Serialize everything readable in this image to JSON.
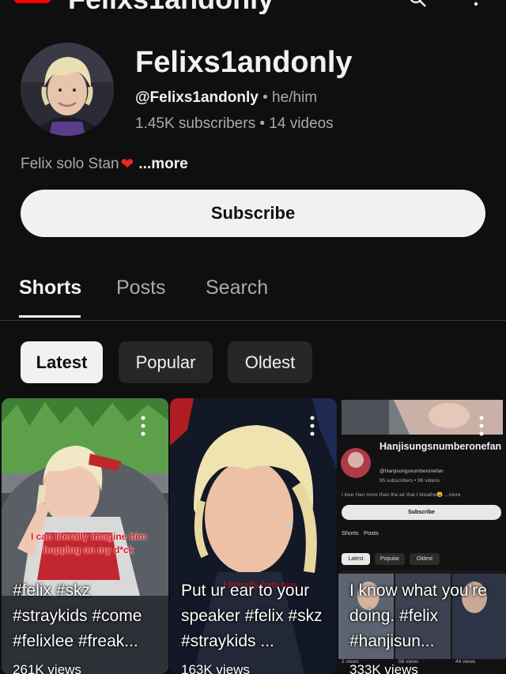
{
  "header": {
    "app_title": "Felixs1andonly"
  },
  "channel": {
    "name": "Felixs1andonly",
    "handle": "@Felixs1andonly",
    "separator": "•",
    "pronouns": "he/him",
    "subscribers": "1.45K subscribers",
    "videos": "14 videos",
    "bio": "Felix solo Stan",
    "bio_emoji": "❤",
    "more_label": "...more",
    "subscribe_label": "Subscribe"
  },
  "tabs": [
    {
      "label": "Shorts",
      "selected": true
    },
    {
      "label": "Posts",
      "selected": false
    },
    {
      "label": "Search",
      "selected": false
    }
  ],
  "chips": [
    {
      "label": "Latest",
      "selected": true
    },
    {
      "label": "Popular",
      "selected": false
    },
    {
      "label": "Oldest",
      "selected": false
    }
  ],
  "shorts": [
    {
      "title": "#felix #skz #straykids #come #felixlee #freak...",
      "views": "261K views",
      "overlay_text": "I can literally imagine him hopping on my d*ck"
    },
    {
      "title": "Put ur ear to your speaker #felix #skz #straykids ...",
      "views": "163K views",
      "overlay_text": "I literally hate him"
    },
    {
      "title": "I know what you’re doing. #felix #hanjisun...",
      "views": "333K views",
      "embedded_channel": {
        "name": "Hanjisungsnumberonefan",
        "handle": "@Hanjisungsnumberonefan",
        "stats": "85 subscribers • 96 videos",
        "bio": "I love Han more than the air that I breathe😩 ...more",
        "subscribe_label": "Subscribe",
        "tabs": [
          "Shorts",
          "Posts"
        ],
        "chips": [
          "Latest",
          "Popular",
          "Oldest"
        ],
        "views": [
          "2 views",
          "56 views",
          "44 views"
        ]
      }
    }
  ],
  "colors": {
    "background": "#0f0f0f",
    "text_primary": "#f1f1f1",
    "text_secondary": "#aaaaaa",
    "chip_inactive": "#272727",
    "brand_red": "#ff0000",
    "heart": "#e22a2a"
  }
}
